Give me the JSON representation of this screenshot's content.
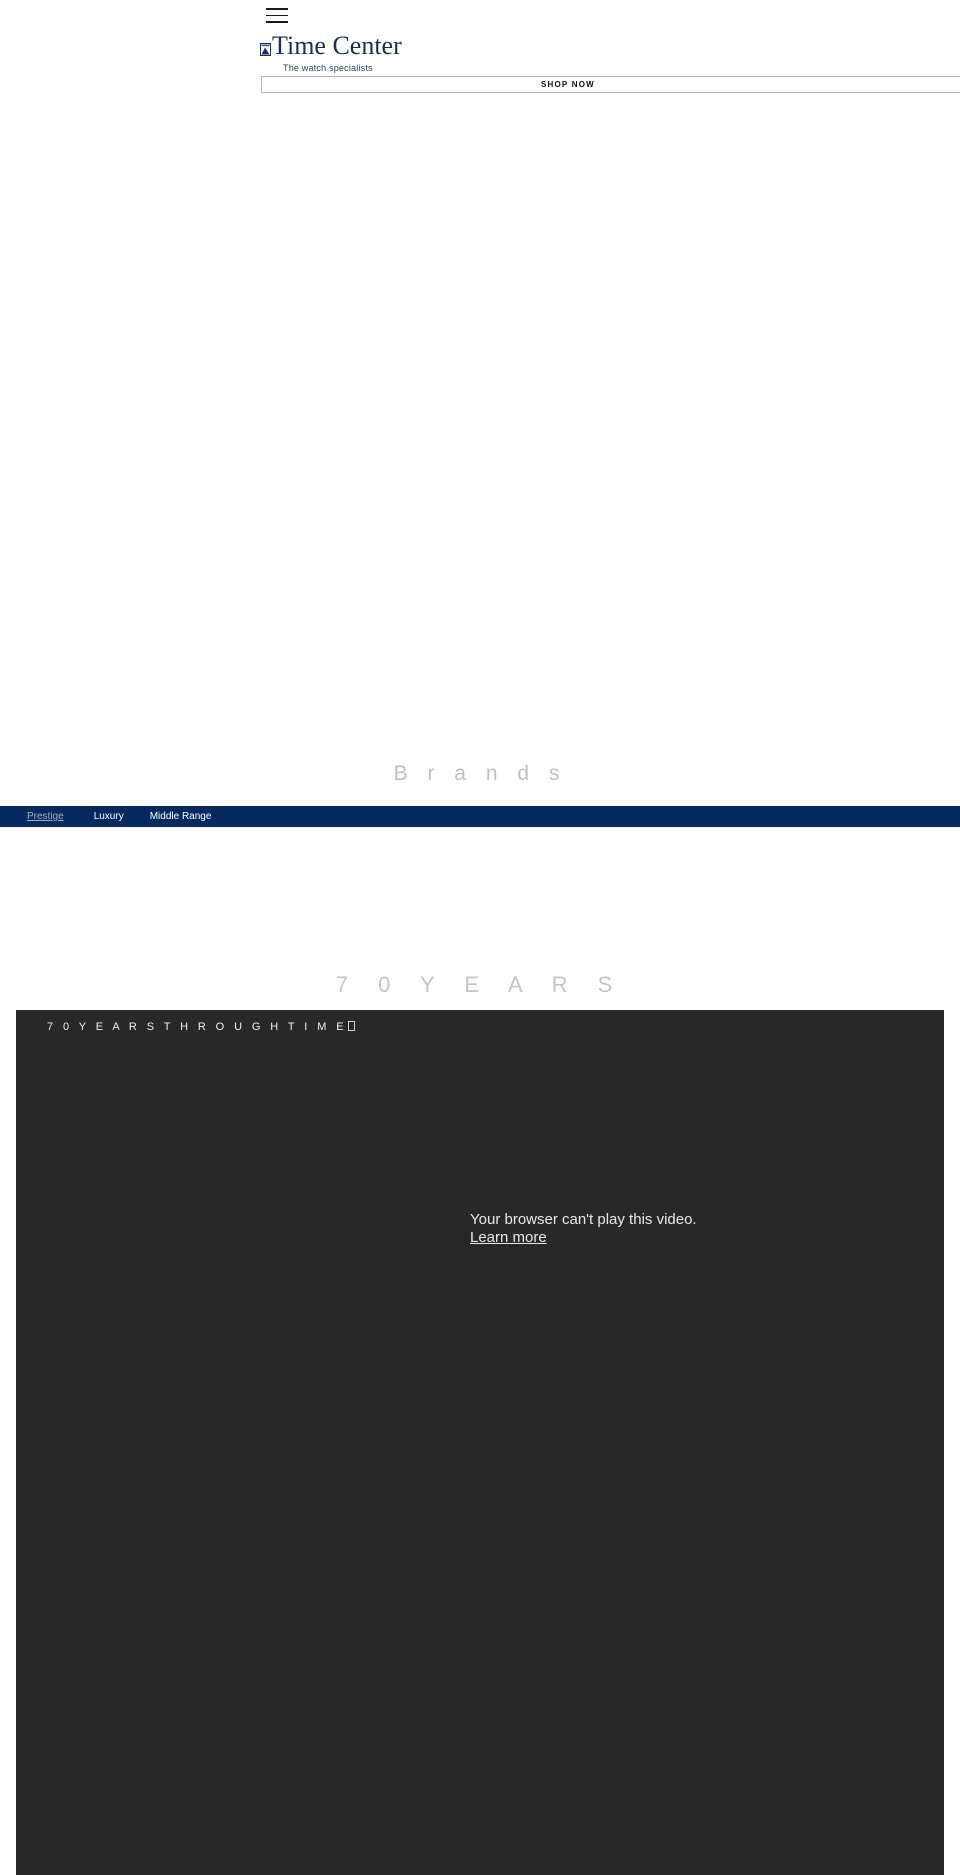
{
  "header": {
    "menu_icon": "hamburger-menu-icon",
    "logo": {
      "broken_image_icon": "broken-image-icon",
      "brand_name": "Time Center",
      "tagline": "The watch specialists"
    },
    "promo_bar": {
      "label": "SHOP NOW"
    }
  },
  "brands": {
    "heading": "B r a n d s",
    "nav": {
      "items": [
        {
          "label": "Prestige",
          "active": true
        },
        {
          "label": "Luxury",
          "active": false
        },
        {
          "label": "Middle Range",
          "active": false
        }
      ]
    }
  },
  "years": {
    "heading": "7 0   Y E A R S"
  },
  "video": {
    "heading": "7 0 Y E A R S T H R O U G H T I M E",
    "heading_trailing_glyph": "missing-glyph-box",
    "error_message": "Your browser can't play this video.",
    "error_link": "Learn more"
  },
  "colors": {
    "brand_navy": "#042a5f",
    "logo_navy": "#1c2f52",
    "panel_dark": "#282828",
    "muted_gray": "#c0c0c0"
  }
}
